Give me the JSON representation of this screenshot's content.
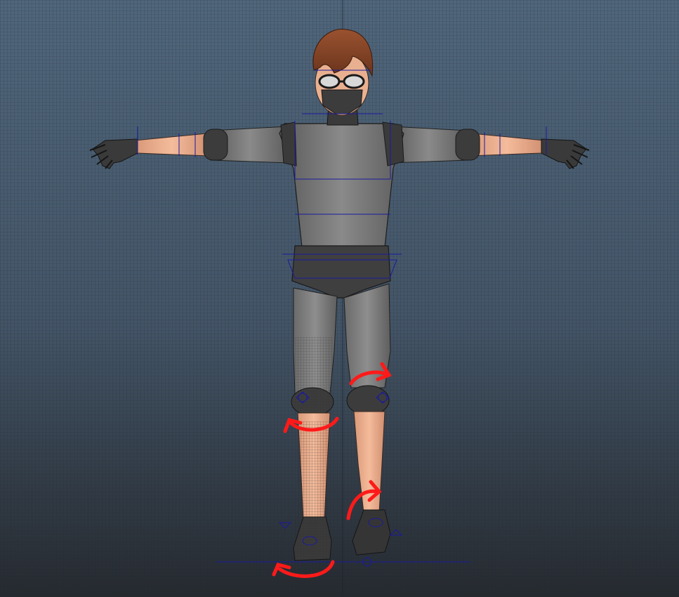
{
  "viewport": {
    "bg_top": "#4d6277",
    "bg_bottom": "#2a2e33",
    "grid_color": "#1d2733",
    "rig_color": "#1a1aa0",
    "annotation_color": "#ff1a1a"
  },
  "character": {
    "skin_color": "#f0b08e",
    "suit_color": "#7c7c7c",
    "suit_dark": "#4a4a4a",
    "hair_color": "#8a4a2a",
    "glove_color": "#3c3c3c"
  },
  "annotations": {
    "count": 4,
    "meaning": "rotation arrows"
  }
}
